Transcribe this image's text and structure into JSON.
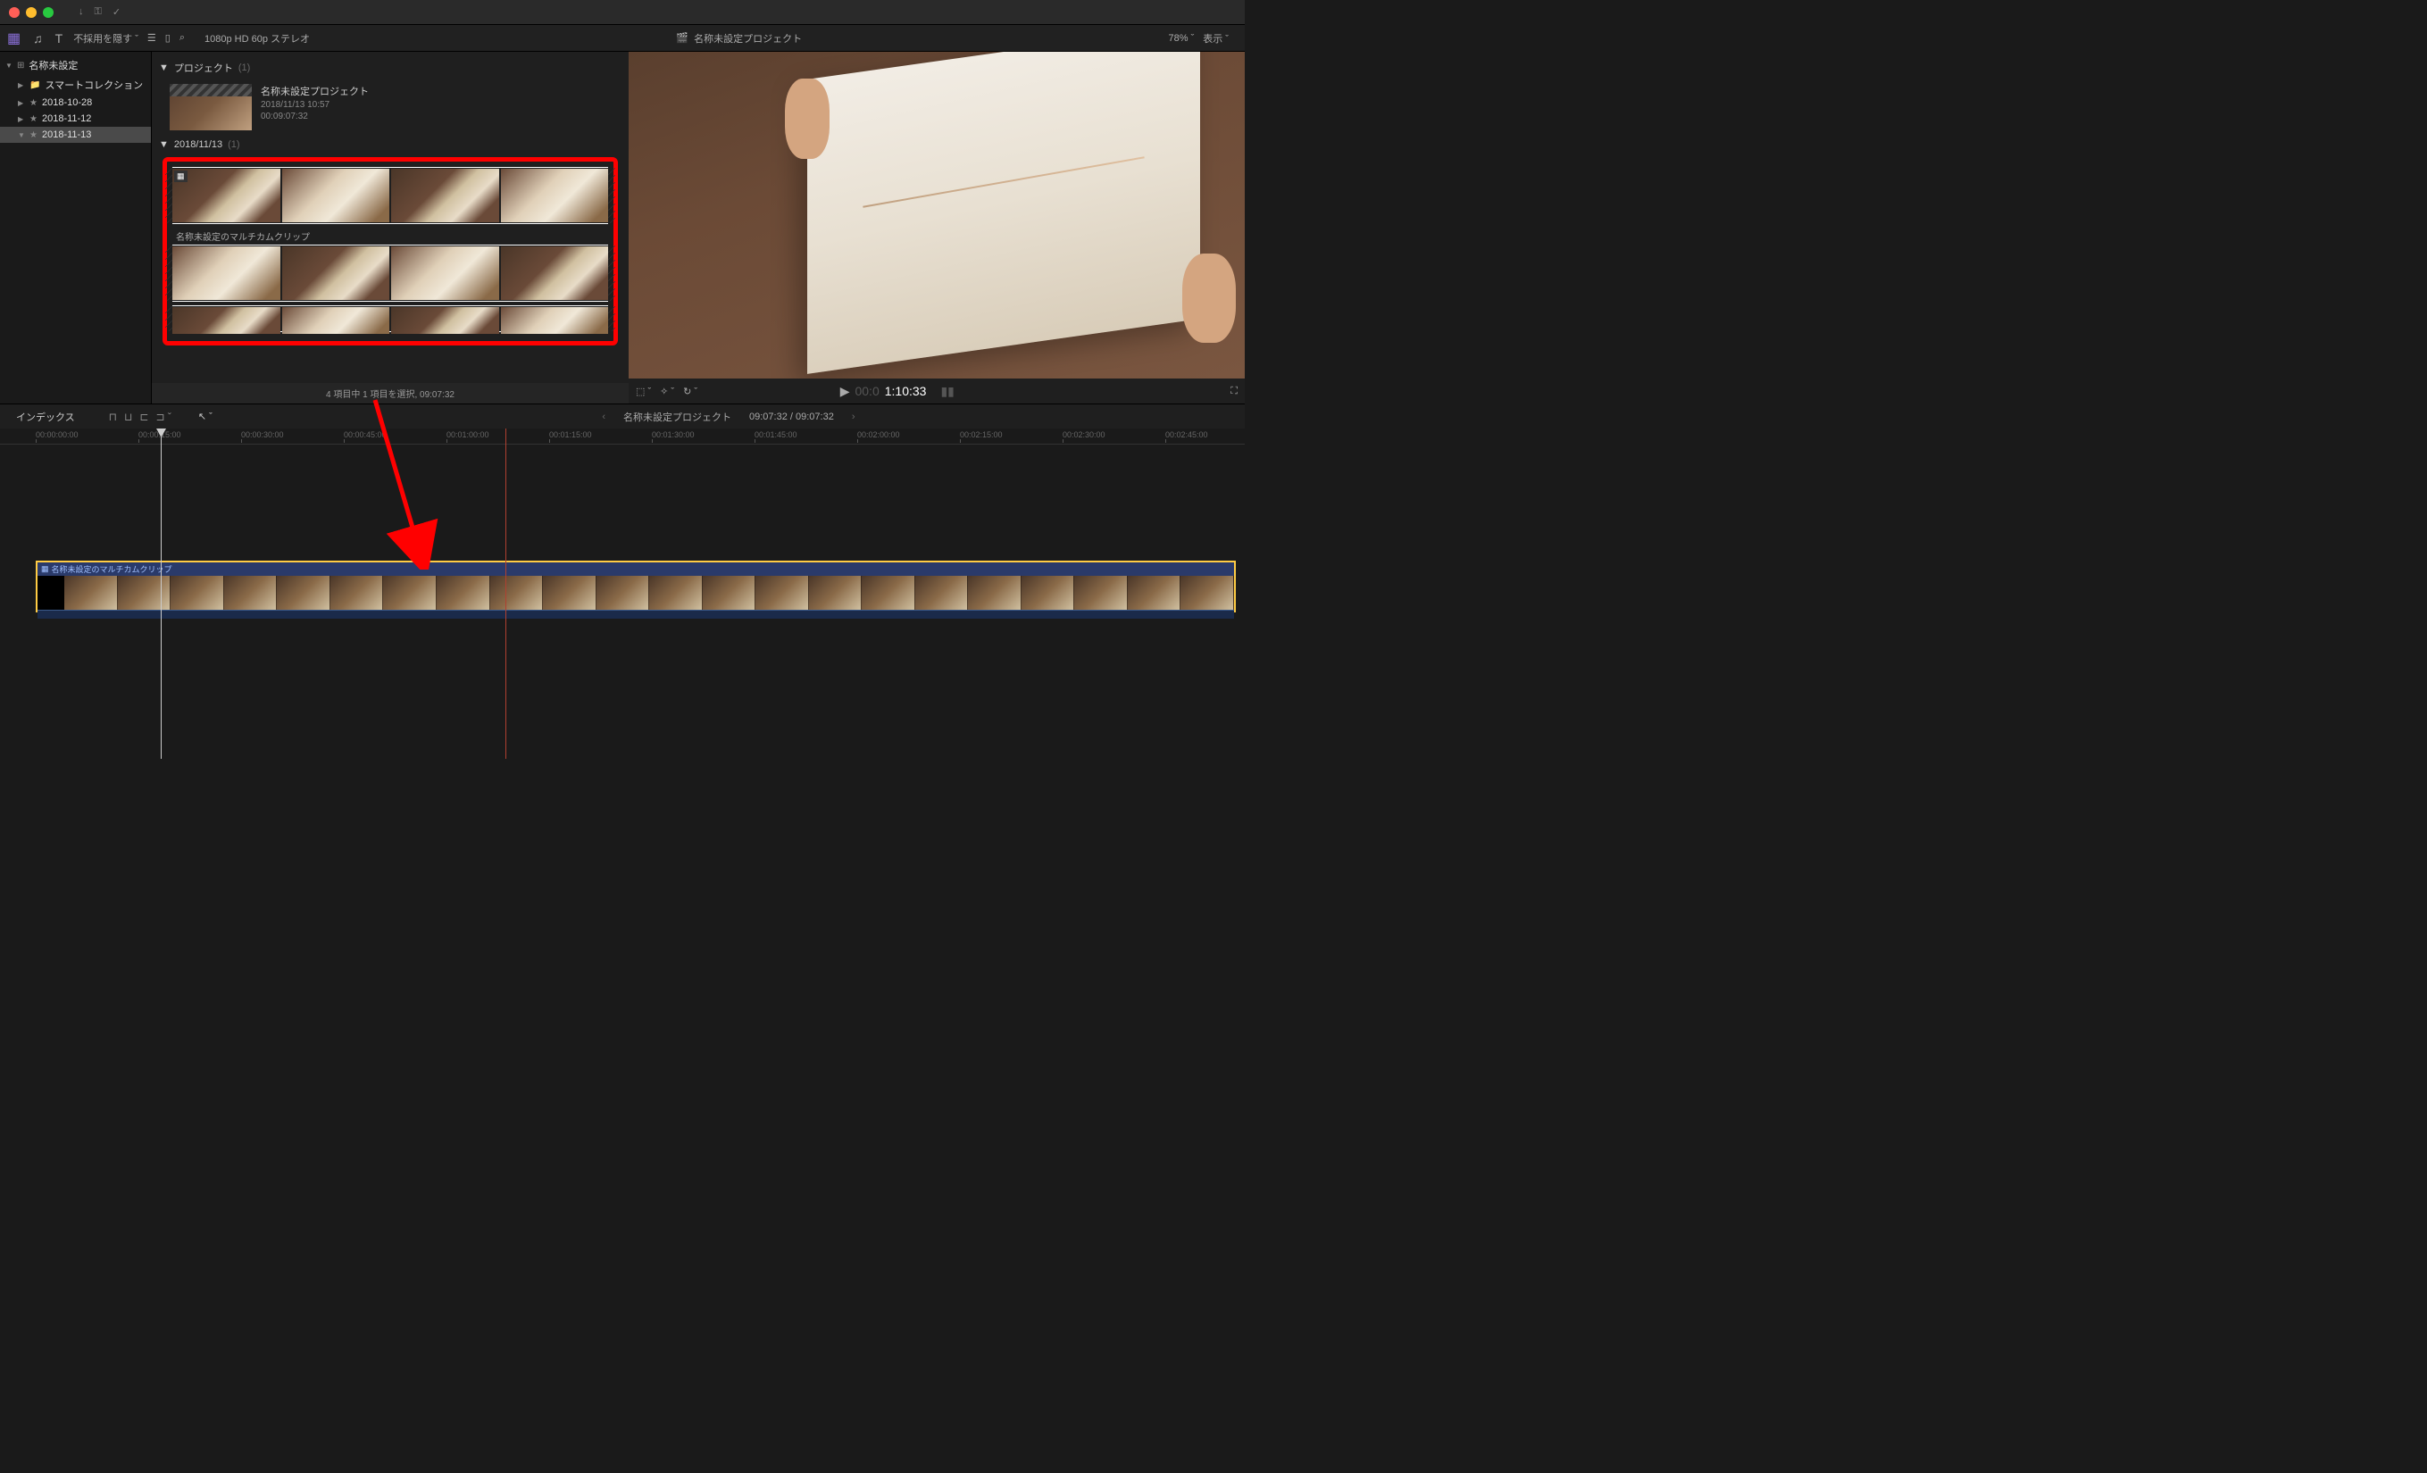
{
  "titlebar": {},
  "toolbar": {
    "hide_rejected": "不採用を隠す",
    "viewer_format": "1080p HD 60p ステレオ",
    "viewer_title": "名称未設定プロジェクト",
    "zoom": "78%",
    "view_menu": "表示"
  },
  "sidebar": {
    "library": "名称未設定",
    "items": [
      {
        "label": "スマートコレクション",
        "icon": "folder"
      },
      {
        "label": "2018-10-28",
        "icon": "event"
      },
      {
        "label": "2018-11-12",
        "icon": "event"
      },
      {
        "label": "2018-11-13",
        "icon": "event",
        "selected": true
      }
    ]
  },
  "browser": {
    "section_projects": "プロジェクト",
    "project_count": "(1)",
    "project": {
      "name": "名称未設定プロジェクト",
      "date": "2018/11/13 10:57",
      "duration": "00:09:07:32"
    },
    "section_date": "2018/11/13",
    "date_count": "(1)",
    "multicam_name": "名称未設定のマルチカムクリップ",
    "status": "4 項目中 1 項目を選択, 09:07:32"
  },
  "viewer_toolbar": {
    "time_dim": "00:0",
    "time_bright": "1:10:33"
  },
  "timeline_toolbar": {
    "index": "インデックス",
    "project_name": "名称未設定プロジェクト",
    "time_status": "09:07:32 / 09:07:32"
  },
  "ruler": {
    "ticks": [
      {
        "pos": 40,
        "label": "00:00:00:00"
      },
      {
        "pos": 155,
        "label": "00:00:15:00"
      },
      {
        "pos": 270,
        "label": "00:00:30:00"
      },
      {
        "pos": 385,
        "label": "00:00:45:00"
      },
      {
        "pos": 500,
        "label": "00:01:00:00"
      },
      {
        "pos": 615,
        "label": "00:01:15:00"
      },
      {
        "pos": 730,
        "label": "00:01:30:00"
      },
      {
        "pos": 845,
        "label": "00:01:45:00"
      },
      {
        "pos": 960,
        "label": "00:02:00:00"
      },
      {
        "pos": 1075,
        "label": "00:02:15:00"
      },
      {
        "pos": 1190,
        "label": "00:02:30:00"
      },
      {
        "pos": 1305,
        "label": "00:02:45:00"
      }
    ]
  },
  "timeline_clip": {
    "name": "名称未設定のマルチカムクリップ"
  }
}
